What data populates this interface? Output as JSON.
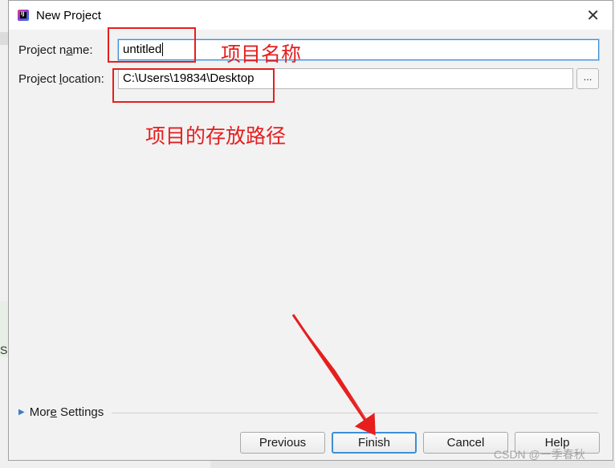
{
  "dialog": {
    "title": "New Project",
    "icon": "intellij-idea-icon",
    "close_glyph": "✕"
  },
  "form": {
    "project_name_label": "Project name:",
    "project_name_value": "untitled",
    "project_location_label": "Project location:",
    "project_location_value": "C:\\Users\\19834\\Desktop",
    "browse_label": "..."
  },
  "more_settings": {
    "label": "More Settings",
    "icon": "triangle-right-icon"
  },
  "buttons": {
    "previous": "Previous",
    "finish": "Finish",
    "cancel": "Cancel",
    "help": "Help"
  },
  "annotations": {
    "name_note": "项目名称",
    "location_note": "项目的存放路径",
    "color": "#e61e1e"
  },
  "background": {
    "side_glyph": "Sc"
  },
  "watermark": "CSDN @一季春秋",
  "colors": {
    "focus_border": "#3d8fd6",
    "dialog_bg": "#f2f2f2"
  }
}
